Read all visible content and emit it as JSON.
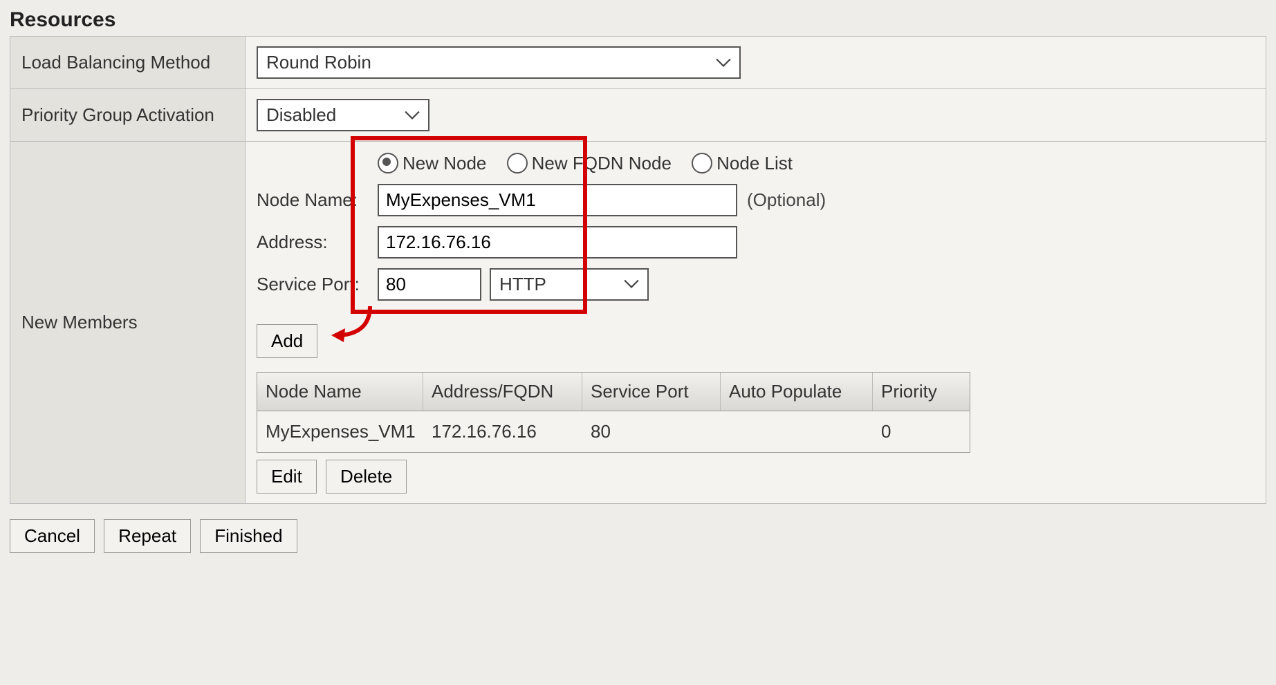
{
  "section_title": "Resources",
  "rows": {
    "load_balancing_label": "Load Balancing Method",
    "load_balancing_value": "Round Robin",
    "priority_group_label": "Priority Group Activation",
    "priority_group_value": "Disabled",
    "new_members_label": "New Members"
  },
  "node_type": {
    "new_node": "New Node",
    "new_fqdn": "New FQDN Node",
    "node_list": "Node List"
  },
  "fields": {
    "node_name_label": "Node Name:",
    "node_name_value": "MyExpenses_VM1",
    "node_name_optional": "(Optional)",
    "address_label": "Address:",
    "address_value": "172.16.76.16",
    "service_port_label": "Service Port:",
    "service_port_value": "80",
    "service_port_proto": "HTTP"
  },
  "buttons": {
    "add": "Add",
    "edit": "Edit",
    "delete": "Delete",
    "cancel": "Cancel",
    "repeat": "Repeat",
    "finished": "Finished"
  },
  "table": {
    "headers": {
      "node_name": "Node Name",
      "address": "Address/FQDN",
      "service_port": "Service Port",
      "auto_populate": "Auto Populate",
      "priority": "Priority"
    },
    "row": {
      "node_name": "MyExpenses_VM1",
      "address": "172.16.76.16",
      "service_port": "80",
      "auto_populate": "",
      "priority": "0"
    }
  }
}
